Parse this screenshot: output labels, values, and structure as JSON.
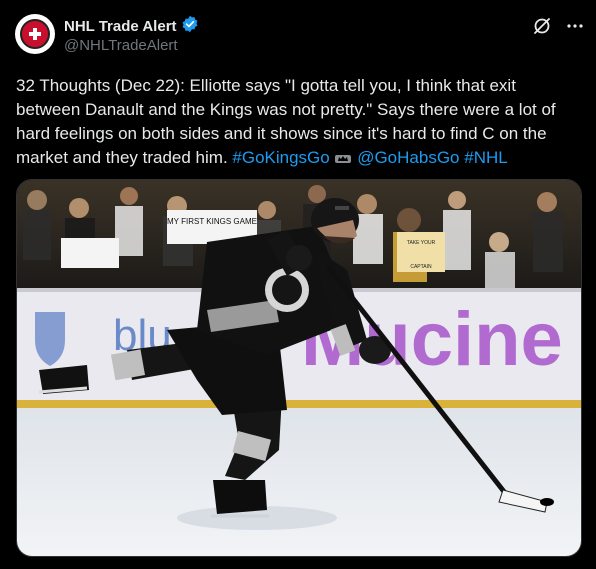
{
  "author": {
    "name": "NHL Trade Alert",
    "handle": "@NHLTradeAlert",
    "verified": true
  },
  "tweet": {
    "text_main": "32 Thoughts (Dec 22): Elliotte says \"I gotta tell you, I think that exit between Danault and the Kings was not pretty.\" Says there were a lot of hard feelings on both sides and it shows since it's hard to find C on the market and they traded him. ",
    "hashtag_kings": "#GoKingsGo",
    "mention_habs": "@GoHabsGo",
    "hashtag_nhl": "#NHL"
  },
  "media": {
    "board_ad_fragment_left": "blu",
    "board_ad_fragment_right": "Mucine",
    "fan_sign_1": "MY FIRST KINGS GAME",
    "fan_sign_2": "TAKE YOUR",
    "fan_sign_3": "CAPTAIN"
  },
  "colors": {
    "background": "#000000",
    "text": "#e7e9ea",
    "secondary": "#71767b",
    "link": "#1d9bf0",
    "verified": "#1d9bf0",
    "brand_red": "#c8102e"
  },
  "icons": [
    "grok-icon",
    "more-icon",
    "verified-badge-icon",
    "kings-crown-emoji-icon"
  ]
}
